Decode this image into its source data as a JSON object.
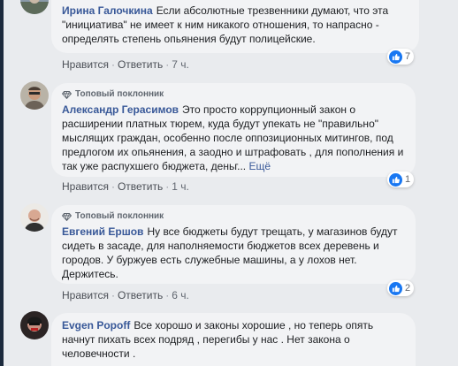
{
  "comments": [
    {
      "author": "Ирина Галочкина",
      "badge": "",
      "text": "Если абсолютные трезвенники думают, что эта \"инициатива\" не имеет к ним никакого отношения, то напрасно - определять степень опьянения будут полицейские.",
      "more": "",
      "like_label": "Нравится",
      "reply_label": "Ответить",
      "time": "7 ч.",
      "reaction_count": "7"
    },
    {
      "author": "Александр Герасимов",
      "badge": "Топовый поклонник",
      "text": "Это просто коррупционный закон о расширении платных тюрем, куда будут упекать не \"правильно\" мыслящих граждан, особенно после оппозиционных митингов, под предлогом их опьянения, а заодно и штрафовать , для пополнения и так уже распухшего бюджета, деньг...",
      "more": "Ещё",
      "like_label": "Нравится",
      "reply_label": "Ответить",
      "time": "1 ч.",
      "reaction_count": "1"
    },
    {
      "author": "Евгений Ершов",
      "badge": "Топовый поклонник",
      "text": "Ну все бюджеты будут трещать, у магазинов будут сидеть в засаде, для наполняемости бюджетов всех деревень и городов. У буржуев есть служебные машины, а у лохов нет. Держитесь.",
      "more": "",
      "like_label": "Нравится",
      "reply_label": "Ответить",
      "time": "6 ч.",
      "reaction_count": "2"
    },
    {
      "author": "Evgen Popoff",
      "badge": "",
      "text": "Все хорошо и законы хорошие , но теперь опять начнут пихать всех подряд , перегибы у нас . Нет закона о человечности .",
      "more": ""
    }
  ],
  "colors": {
    "link": "#385898",
    "bubble": "#f2f3f5",
    "like": "#1877f2",
    "background": "#e9ebee"
  },
  "icons": {
    "badge": "diamond-icon",
    "reaction": "like-icon"
  }
}
